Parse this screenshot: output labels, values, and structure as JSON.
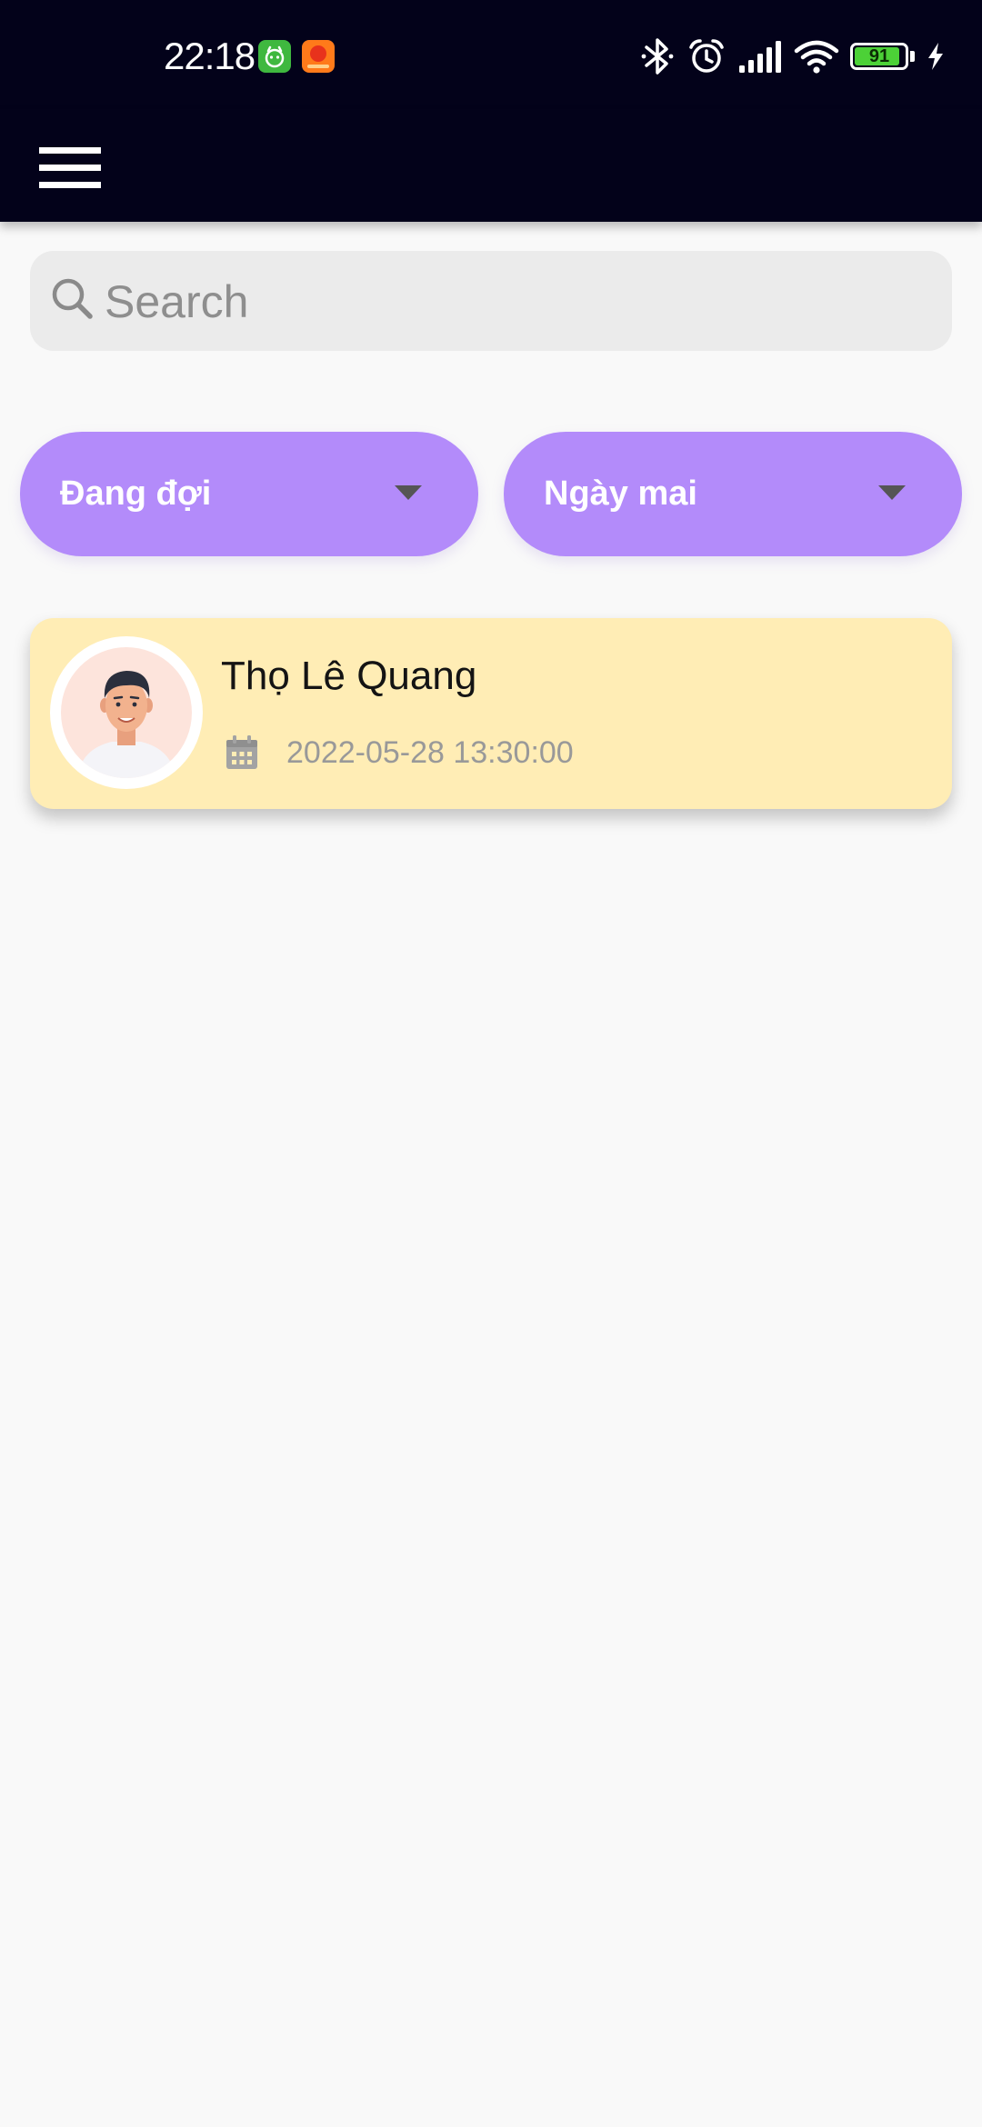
{
  "status_bar": {
    "time": "22:18",
    "battery": "91",
    "colors": {
      "background": "#03021a",
      "battery_fill": "#4cd137"
    },
    "icons": [
      "app-notification-icon",
      "app-notification-icon",
      "bluetooth-icon",
      "alarm-icon",
      "signal-icon",
      "wifi-icon",
      "battery-icon",
      "charging-icon"
    ]
  },
  "app_bar": {
    "menu_icon": "hamburger-menu-icon"
  },
  "search": {
    "placeholder": "Search",
    "value": "",
    "icon": "search-icon"
  },
  "filters": {
    "status": {
      "label": "Đang đợi",
      "icon": "caret-down-icon"
    },
    "date": {
      "label": "Ngày mai",
      "icon": "caret-down-icon"
    },
    "colors": {
      "background": "#b38bfa",
      "text": "#ffffff"
    }
  },
  "appointments": [
    {
      "name": "Thọ Lê Quang",
      "datetime": "2022-05-28 13:30:00",
      "avatar_icon": "user-avatar",
      "date_icon": "calendar-icon",
      "card_color": "#ffedb5"
    }
  ]
}
